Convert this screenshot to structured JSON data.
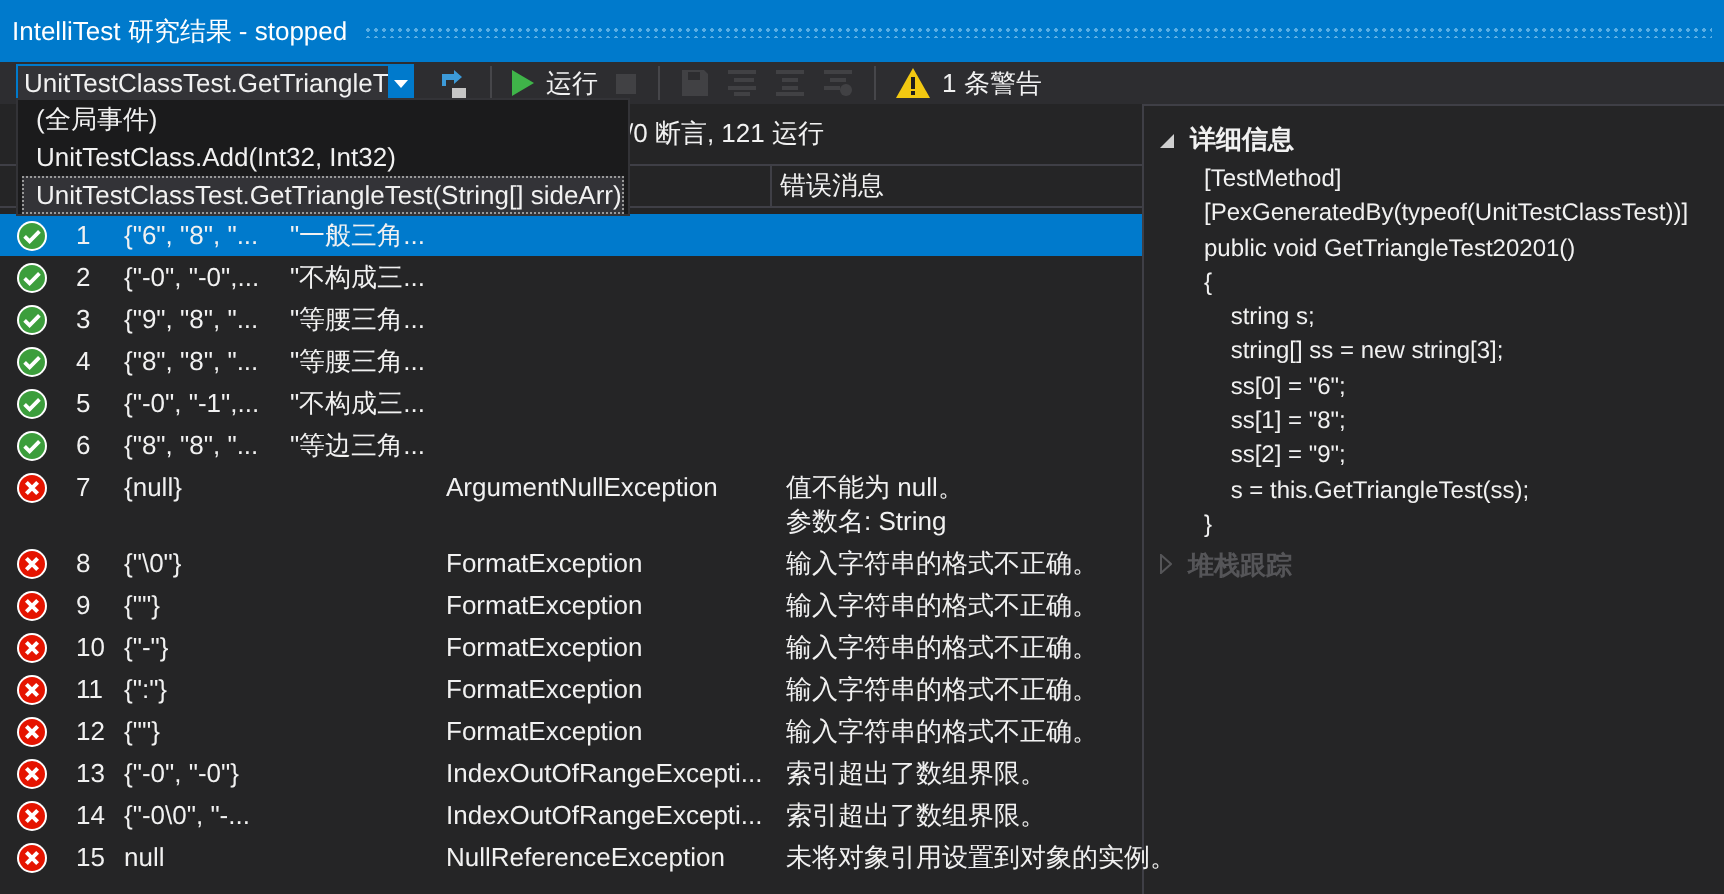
{
  "window": {
    "title": "IntelliTest 研究结果 - stopped"
  },
  "toolbar": {
    "method_combo": {
      "value": "UnitTestClassTest.GetTriangleT",
      "expanded": true,
      "options": [
        {
          "label": "(全局事件)",
          "selected": false
        },
        {
          "label": "UnitTestClass.Add(Int32, Int32)",
          "selected": false
        },
        {
          "label": "UnitTestClassTest.GetTriangleTest(String[] sideArr)",
          "selected": true
        }
      ]
    },
    "buttons": [
      {
        "kind": "export",
        "disabled": false
      },
      {
        "kind": "run",
        "label": "运行",
        "disabled": false
      },
      {
        "kind": "stop",
        "disabled": true
      },
      {
        "kind": "save",
        "disabled": true
      },
      {
        "kind": "tool_a",
        "disabled": true
      },
      {
        "kind": "tool_b",
        "disabled": true
      },
      {
        "kind": "tool_c",
        "disabled": true
      },
      {
        "kind": "warning",
        "label": "1 条警告",
        "disabled": false
      }
    ]
  },
  "summary": "/0 断言, 121 运行",
  "table": {
    "columns": [
      {
        "label": "错误消息"
      }
    ],
    "rows": [
      {
        "passed": true,
        "selected": true,
        "number": "1",
        "args": "{\"6\", \"8\", \"...",
        "result": "\"一般三角..."
      },
      {
        "passed": true,
        "selected": false,
        "number": "2",
        "args": "{\"-0\", \"-0\",...",
        "result": "\"不构成三..."
      },
      {
        "passed": true,
        "selected": false,
        "number": "3",
        "args": "{\"9\", \"8\", \"...",
        "result": "\"等腰三角..."
      },
      {
        "passed": true,
        "selected": false,
        "number": "4",
        "args": "{\"8\", \"8\", \"...",
        "result": "\"等腰三角..."
      },
      {
        "passed": true,
        "selected": false,
        "number": "5",
        "args": "{\"-0\", \"-1\",...",
        "result": "\"不构成三..."
      },
      {
        "passed": true,
        "selected": false,
        "number": "6",
        "args": "{\"8\", \"8\", \"...",
        "result": "\"等边三角..."
      },
      {
        "passed": false,
        "selected": false,
        "number": "7",
        "args": "{null}",
        "exception": "ArgumentNullException",
        "message_lines": [
          "值不能为 null。",
          "参数名: String"
        ]
      },
      {
        "passed": false,
        "selected": false,
        "number": "8",
        "args": "{\"\\0\"}",
        "exception": "FormatException",
        "message_lines": [
          "输入字符串的格式不正确。"
        ]
      },
      {
        "passed": false,
        "selected": false,
        "number": "9",
        "args": "{\"\"}",
        "exception": "FormatException",
        "message_lines": [
          "输入字符串的格式不正确。"
        ]
      },
      {
        "passed": false,
        "selected": false,
        "number": "10",
        "args": "{\"-\"}",
        "exception": "FormatException",
        "message_lines": [
          "输入字符串的格式不正确。"
        ]
      },
      {
        "passed": false,
        "selected": false,
        "number": "11",
        "args": "{\":\"}",
        "exception": "FormatException",
        "message_lines": [
          "输入字符串的格式不正确。"
        ]
      },
      {
        "passed": false,
        "selected": false,
        "number": "12",
        "args": "{\"\"}",
        "exception": "FormatException",
        "message_lines": [
          "输入字符串的格式不正确。"
        ]
      },
      {
        "passed": false,
        "selected": false,
        "number": "13",
        "args": "{\"-0\", \"-0\"}",
        "exception": "IndexOutOfRangeExcepti...",
        "message_lines": [
          "索引超出了数组界限。"
        ]
      },
      {
        "passed": false,
        "selected": false,
        "number": "14",
        "args": "{\"-0\\0\", \"-...",
        "exception": "IndexOutOfRangeExcepti...",
        "message_lines": [
          "索引超出了数组界限。"
        ]
      },
      {
        "passed": false,
        "selected": false,
        "number": "15",
        "args": "null",
        "exception": "NullReferenceException",
        "message_lines": [
          "未将对象引用设置到对象的实例。"
        ]
      }
    ]
  },
  "details": {
    "sections": [
      {
        "title": "详细信息",
        "expanded": true,
        "lines": [
          "[TestMethod]",
          "[PexGeneratedBy(typeof(UnitTestClassTest))]",
          "public void GetTriangleTest20201()",
          "{",
          "    string s;",
          "    string[] ss = new string[3];",
          "    ss[0] = \"6\";",
          "    ss[1] = \"8\";",
          "    ss[2] = \"9\";",
          "    s = this.GetTriangleTest(ss);",
          "}"
        ]
      },
      {
        "title": "堆栈跟踪",
        "expanded": false
      }
    ]
  }
}
